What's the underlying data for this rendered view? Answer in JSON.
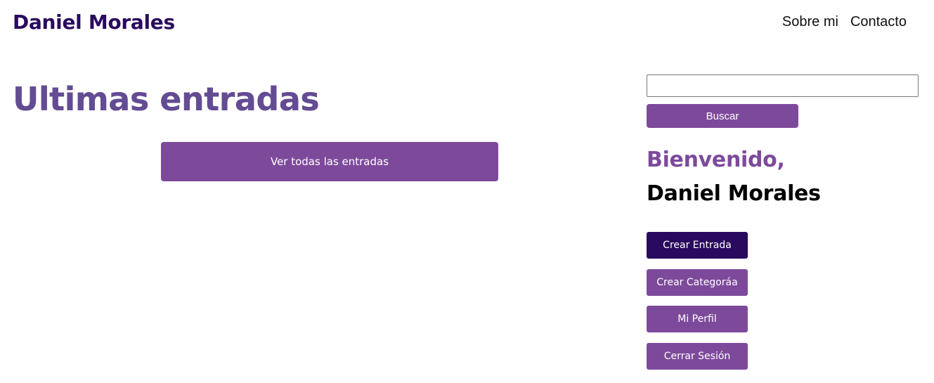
{
  "header": {
    "logo": "Daniel Morales",
    "nav": [
      "Sobre mi",
      "Contacto"
    ]
  },
  "main": {
    "title": "Ultimas entradas",
    "all_entries_button": "Ver todas las entradas"
  },
  "sidebar": {
    "search": {
      "value": "",
      "placeholder": "",
      "button_label": "Buscar"
    },
    "welcome": "Bienvenido,",
    "user_name": "Daniel Morales",
    "actions": [
      "Crear Entrada",
      "Crear Categoráa",
      "Mi Perfil",
      "Cerrar Sesión"
    ]
  },
  "colors": {
    "brand_dark": "#2a0a5e",
    "brand_purple": "#7d4a9b"
  }
}
